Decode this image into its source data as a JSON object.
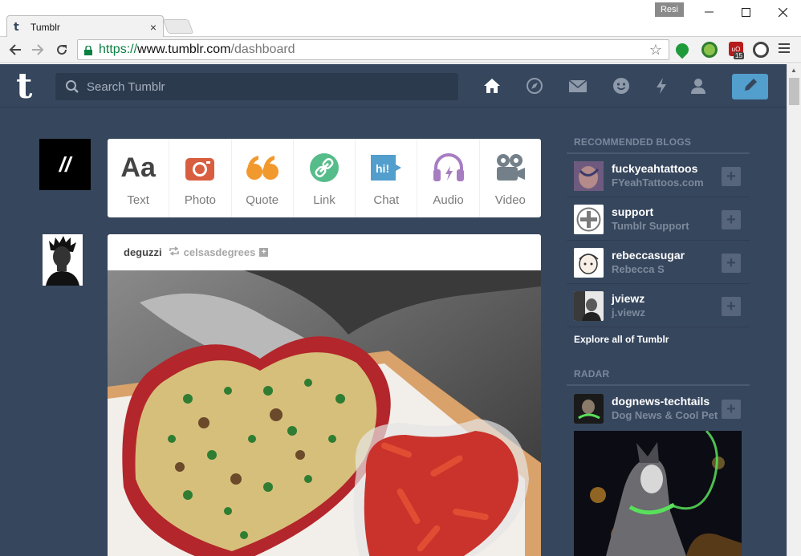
{
  "browser": {
    "tab_title": "Tumblr",
    "tab_close": "×",
    "user_badge": "Resi",
    "url_scheme": "https://",
    "url_host": "www.tumblr.com",
    "url_path": "/dashboard",
    "ext_badge": "15",
    "ext_ublock": "uO"
  },
  "header": {
    "logo": "t",
    "search_placeholder": "Search Tumblr"
  },
  "user_avatar_text": "//",
  "post_types": [
    {
      "label": "Text",
      "icon": "text-icon",
      "color": "#444444"
    },
    {
      "label": "Photo",
      "icon": "camera-icon",
      "color": "#d95e40"
    },
    {
      "label": "Quote",
      "icon": "quote-icon",
      "color": "#f2992e"
    },
    {
      "label": "Link",
      "icon": "link-icon",
      "color": "#56bc8a"
    },
    {
      "label": "Chat",
      "icon": "chat-icon",
      "color": "#529ecc"
    },
    {
      "label": "Audio",
      "icon": "headphones-icon",
      "color": "#a77dc2"
    },
    {
      "label": "Video",
      "icon": "video-camera-icon",
      "color": "#748089"
    }
  ],
  "post": {
    "author": "deguzzi",
    "source": "celsasdegrees",
    "follow_mini": "+"
  },
  "sidebar": {
    "recommended_title": "RECOMMENDED BLOGS",
    "blogs": [
      {
        "name": "fuckyeahtattoos",
        "title": "FYeahTattoos.com"
      },
      {
        "name": "support",
        "title": "Tumblr Support"
      },
      {
        "name": "rebeccasugar",
        "title": "Rebecca S"
      },
      {
        "name": "jviewz",
        "title": "j.viewz"
      }
    ],
    "follow_label": "+",
    "explore_link": "Explore all of Tumblr",
    "radar_title": "RADAR",
    "radar": {
      "name": "dognews-techtails",
      "title": "Dog News & Cool Pet"
    }
  },
  "colors": {
    "dashboard_bg": "#36465d",
    "compose_blue": "#529ecc",
    "url_green": "#0b8043"
  }
}
